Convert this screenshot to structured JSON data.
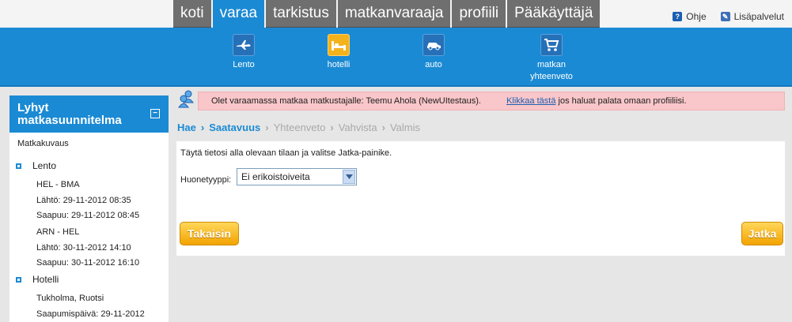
{
  "tabs": [
    {
      "label": "koti",
      "active": false
    },
    {
      "label": "varaa",
      "active": true
    },
    {
      "label": "tarkistus",
      "active": false
    },
    {
      "label": "matkanvaraaja",
      "active": false
    },
    {
      "label": "profiili",
      "active": false
    },
    {
      "label": "Pääkäyttäjä",
      "active": false
    }
  ],
  "help_links": {
    "help": "Ohje",
    "extra_services": "Lisäpalvelut"
  },
  "nav": {
    "flight": {
      "label": "Lento",
      "icon": "airplane-icon"
    },
    "hotel": {
      "label": "hotelli",
      "icon": "bed-icon"
    },
    "car": {
      "label": "auto",
      "icon": "car-icon"
    },
    "summary": {
      "label_line1": "matkan",
      "label_line2": "yhteenveto",
      "icon": "shopping-cart-icon"
    }
  },
  "sidebar": {
    "title_line1": "Lyhyt",
    "title_line2": "matkasuunnitelma",
    "description_label": "Matkakuvaus",
    "flight_section": "Lento",
    "flight1_route": "HEL - BMA",
    "flight1_departure": "Lähtö: 29-11-2012 08:35",
    "flight1_arrival": "Saapuu: 29-11-2012 08:45",
    "flight2_route": "ARN - HEL",
    "flight2_departure": "Lähtö: 30-11-2012 14:10",
    "flight2_arrival": "Saapuu: 30-11-2012 16:10",
    "hotel_section": "Hotelli",
    "hotel_location": "Tukholma, Ruotsi",
    "hotel_arrival": "Saapumispäivä: 29-11-2012"
  },
  "notice": {
    "text": "Olet varaamassa matkaa matkustajalle: Teemu Ahola  (NewUItestaus).",
    "link": "Klikkaa  tästä",
    "suffix": "jos haluat palata omaan profiiliisi."
  },
  "breadcrumb": {
    "step1": "Hae",
    "step2": "Saatavuus",
    "step3": "Yhteenveto",
    "step4": "Vahvista",
    "step5": "Valmis"
  },
  "form": {
    "instruction": "Täytä tietosi alla olevaan tilaan ja valitse Jatka-painike.",
    "room_type_label": "Huonetyyppi:",
    "room_type_value": "Ei erikoistoiveita"
  },
  "buttons": {
    "back": "Takaisin",
    "next": "Jatka"
  },
  "colors": {
    "accent": "#1b8ad4",
    "tab_grey": "#6f6f6f",
    "button_gold": "#f2a300",
    "notice_bg": "#f9c6c9"
  }
}
